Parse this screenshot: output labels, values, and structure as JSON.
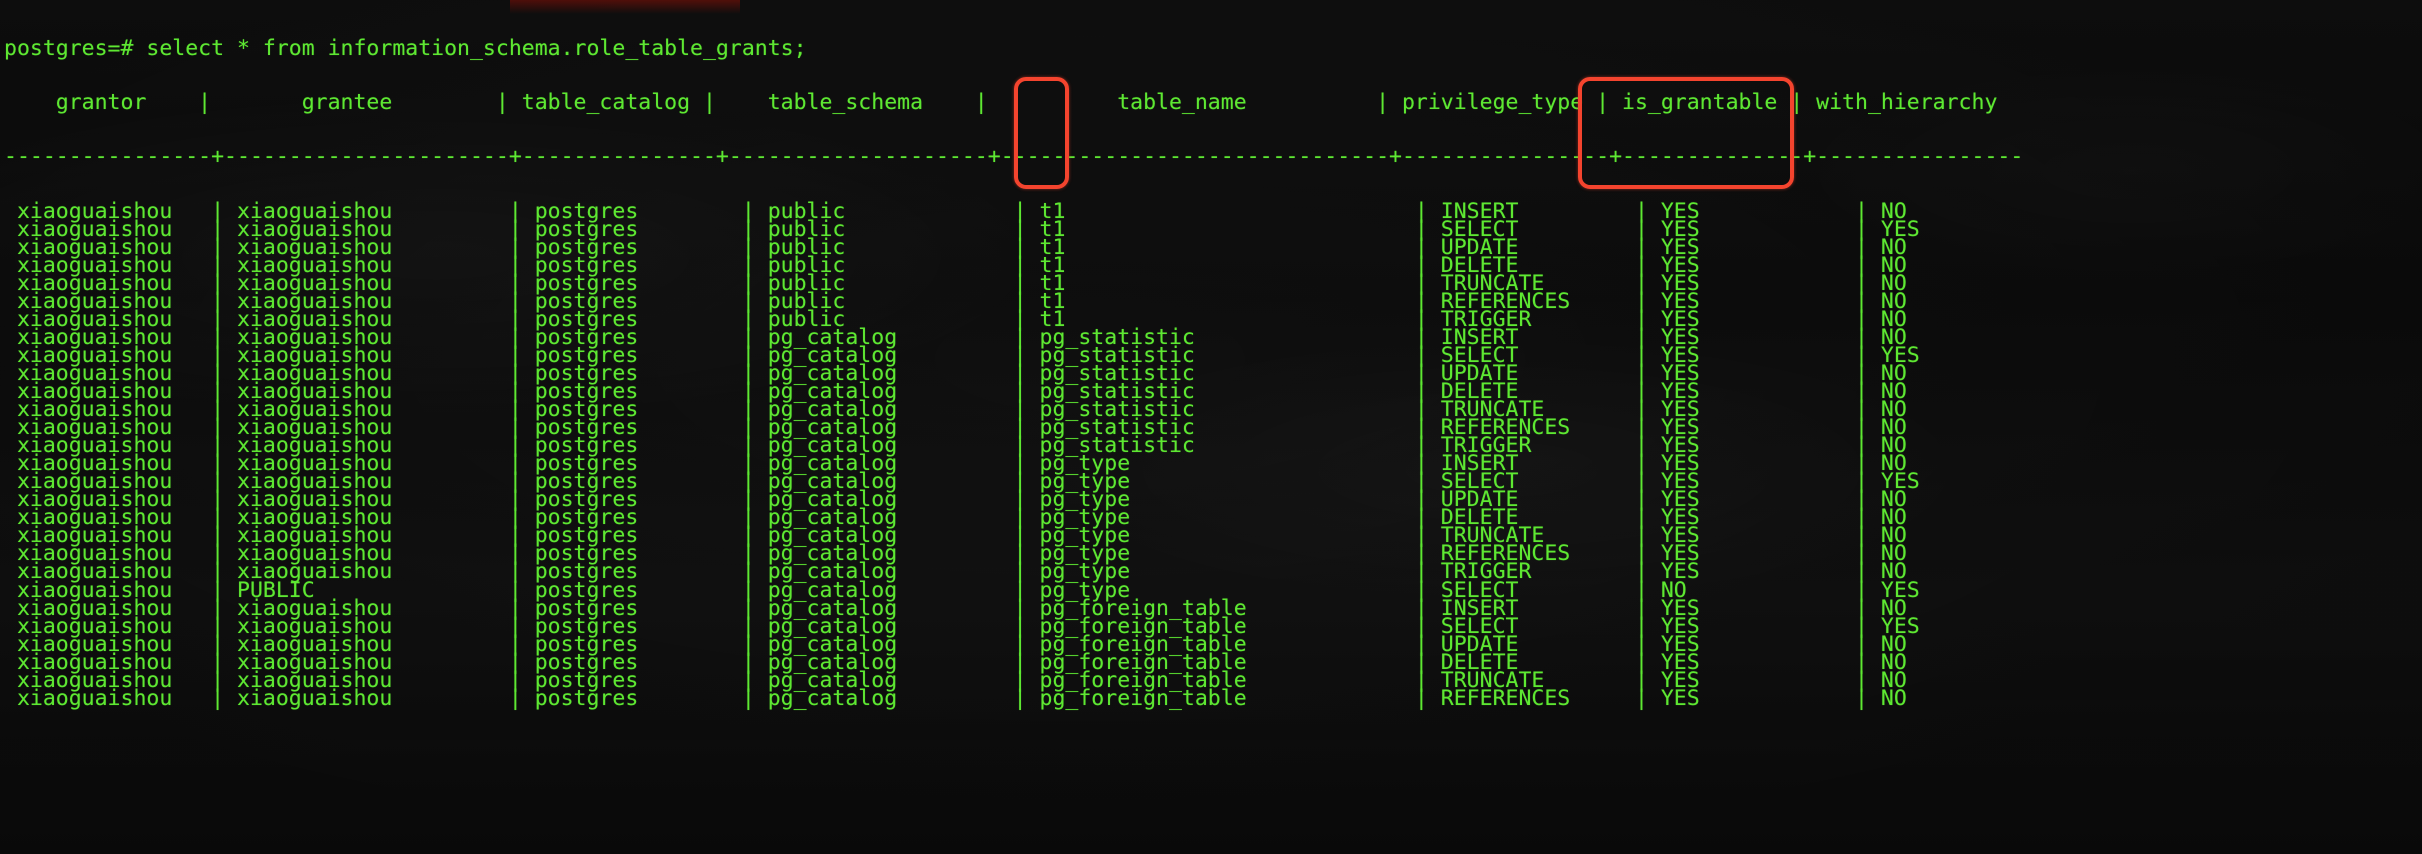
{
  "terminal": {
    "prompt": "postgres=#",
    "command": "select * from information_schema.role_table_grants;",
    "prompt_line": "postgres=# select * from information_schema.role_table_grants;",
    "colors": {
      "foreground": "#5ee832",
      "background": "#111111",
      "highlight": "#f4442e"
    },
    "columns": [
      {
        "name": "grantor",
        "width": 14,
        "align": "center"
      },
      {
        "name": "grantee",
        "width": 20,
        "align": "center"
      },
      {
        "name": "table_catalog",
        "width": 15,
        "align": "center"
      },
      {
        "name": "table_schema",
        "width": 18,
        "align": "center"
      },
      {
        "name": "table_name",
        "width": 28,
        "align": "center"
      },
      {
        "name": "privilege_type",
        "width": 14,
        "align": "center"
      },
      {
        "name": "is_grantable",
        "width": 14,
        "align": "center"
      },
      {
        "name": "with_hierarchy",
        "width": 14,
        "align": "center"
      }
    ],
    "header_line": "    grantor    |       grantee        | table_catalog |    table_schema    |          table_name          | privilege_type | is_grantable | with_hierarchy",
    "separator_line": "----------------+----------------------+---------------+--------------------+------------------------------+----------------+--------------+----------------",
    "rows": [
      {
        "grantor": "xiaoguaishou",
        "grantee": "xiaoguaishou",
        "table_catalog": "postgres",
        "table_schema": "public",
        "table_name": "t1",
        "privilege_type": "INSERT",
        "is_grantable": "YES",
        "with_hierarchy": "NO"
      },
      {
        "grantor": "xiaoguaishou",
        "grantee": "xiaoguaishou",
        "table_catalog": "postgres",
        "table_schema": "public",
        "table_name": "t1",
        "privilege_type": "SELECT",
        "is_grantable": "YES",
        "with_hierarchy": "YES"
      },
      {
        "grantor": "xiaoguaishou",
        "grantee": "xiaoguaishou",
        "table_catalog": "postgres",
        "table_schema": "public",
        "table_name": "t1",
        "privilege_type": "UPDATE",
        "is_grantable": "YES",
        "with_hierarchy": "NO"
      },
      {
        "grantor": "xiaoguaishou",
        "grantee": "xiaoguaishou",
        "table_catalog": "postgres",
        "table_schema": "public",
        "table_name": "t1",
        "privilege_type": "DELETE",
        "is_grantable": "YES",
        "with_hierarchy": "NO"
      },
      {
        "grantor": "xiaoguaishou",
        "grantee": "xiaoguaishou",
        "table_catalog": "postgres",
        "table_schema": "public",
        "table_name": "t1",
        "privilege_type": "TRUNCATE",
        "is_grantable": "YES",
        "with_hierarchy": "NO"
      },
      {
        "grantor": "xiaoguaishou",
        "grantee": "xiaoguaishou",
        "table_catalog": "postgres",
        "table_schema": "public",
        "table_name": "t1",
        "privilege_type": "REFERENCES",
        "is_grantable": "YES",
        "with_hierarchy": "NO"
      },
      {
        "grantor": "xiaoguaishou",
        "grantee": "xiaoguaishou",
        "table_catalog": "postgres",
        "table_schema": "public",
        "table_name": "t1",
        "privilege_type": "TRIGGER",
        "is_grantable": "YES",
        "with_hierarchy": "NO"
      },
      {
        "grantor": "xiaoguaishou",
        "grantee": "xiaoguaishou",
        "table_catalog": "postgres",
        "table_schema": "pg_catalog",
        "table_name": "pg_statistic",
        "privilege_type": "INSERT",
        "is_grantable": "YES",
        "with_hierarchy": "NO"
      },
      {
        "grantor": "xiaoguaishou",
        "grantee": "xiaoguaishou",
        "table_catalog": "postgres",
        "table_schema": "pg_catalog",
        "table_name": "pg_statistic",
        "privilege_type": "SELECT",
        "is_grantable": "YES",
        "with_hierarchy": "YES"
      },
      {
        "grantor": "xiaoguaishou",
        "grantee": "xiaoguaishou",
        "table_catalog": "postgres",
        "table_schema": "pg_catalog",
        "table_name": "pg_statistic",
        "privilege_type": "UPDATE",
        "is_grantable": "YES",
        "with_hierarchy": "NO"
      },
      {
        "grantor": "xiaoguaishou",
        "grantee": "xiaoguaishou",
        "table_catalog": "postgres",
        "table_schema": "pg_catalog",
        "table_name": "pg_statistic",
        "privilege_type": "DELETE",
        "is_grantable": "YES",
        "with_hierarchy": "NO"
      },
      {
        "grantor": "xiaoguaishou",
        "grantee": "xiaoguaishou",
        "table_catalog": "postgres",
        "table_schema": "pg_catalog",
        "table_name": "pg_statistic",
        "privilege_type": "TRUNCATE",
        "is_grantable": "YES",
        "with_hierarchy": "NO"
      },
      {
        "grantor": "xiaoguaishou",
        "grantee": "xiaoguaishou",
        "table_catalog": "postgres",
        "table_schema": "pg_catalog",
        "table_name": "pg_statistic",
        "privilege_type": "REFERENCES",
        "is_grantable": "YES",
        "with_hierarchy": "NO"
      },
      {
        "grantor": "xiaoguaishou",
        "grantee": "xiaoguaishou",
        "table_catalog": "postgres",
        "table_schema": "pg_catalog",
        "table_name": "pg_statistic",
        "privilege_type": "TRIGGER",
        "is_grantable": "YES",
        "with_hierarchy": "NO"
      },
      {
        "grantor": "xiaoguaishou",
        "grantee": "xiaoguaishou",
        "table_catalog": "postgres",
        "table_schema": "pg_catalog",
        "table_name": "pg_type",
        "privilege_type": "INSERT",
        "is_grantable": "YES",
        "with_hierarchy": "NO"
      },
      {
        "grantor": "xiaoguaishou",
        "grantee": "xiaoguaishou",
        "table_catalog": "postgres",
        "table_schema": "pg_catalog",
        "table_name": "pg_type",
        "privilege_type": "SELECT",
        "is_grantable": "YES",
        "with_hierarchy": "YES"
      },
      {
        "grantor": "xiaoguaishou",
        "grantee": "xiaoguaishou",
        "table_catalog": "postgres",
        "table_schema": "pg_catalog",
        "table_name": "pg_type",
        "privilege_type": "UPDATE",
        "is_grantable": "YES",
        "with_hierarchy": "NO"
      },
      {
        "grantor": "xiaoguaishou",
        "grantee": "xiaoguaishou",
        "table_catalog": "postgres",
        "table_schema": "pg_catalog",
        "table_name": "pg_type",
        "privilege_type": "DELETE",
        "is_grantable": "YES",
        "with_hierarchy": "NO"
      },
      {
        "grantor": "xiaoguaishou",
        "grantee": "xiaoguaishou",
        "table_catalog": "postgres",
        "table_schema": "pg_catalog",
        "table_name": "pg_type",
        "privilege_type": "TRUNCATE",
        "is_grantable": "YES",
        "with_hierarchy": "NO"
      },
      {
        "grantor": "xiaoguaishou",
        "grantee": "xiaoguaishou",
        "table_catalog": "postgres",
        "table_schema": "pg_catalog",
        "table_name": "pg_type",
        "privilege_type": "REFERENCES",
        "is_grantable": "YES",
        "with_hierarchy": "NO"
      },
      {
        "grantor": "xiaoguaishou",
        "grantee": "xiaoguaishou",
        "table_catalog": "postgres",
        "table_schema": "pg_catalog",
        "table_name": "pg_type",
        "privilege_type": "TRIGGER",
        "is_grantable": "YES",
        "with_hierarchy": "NO"
      },
      {
        "grantor": "xiaoguaishou",
        "grantee": "PUBLIC",
        "table_catalog": "postgres",
        "table_schema": "pg_catalog",
        "table_name": "pg_type",
        "privilege_type": "SELECT",
        "is_grantable": "NO",
        "with_hierarchy": "YES"
      },
      {
        "grantor": "xiaoguaishou",
        "grantee": "xiaoguaishou",
        "table_catalog": "postgres",
        "table_schema": "pg_catalog",
        "table_name": "pg_foreign_table",
        "privilege_type": "INSERT",
        "is_grantable": "YES",
        "with_hierarchy": "NO"
      },
      {
        "grantor": "xiaoguaishou",
        "grantee": "xiaoguaishou",
        "table_catalog": "postgres",
        "table_schema": "pg_catalog",
        "table_name": "pg_foreign_table",
        "privilege_type": "SELECT",
        "is_grantable": "YES",
        "with_hierarchy": "YES"
      },
      {
        "grantor": "xiaoguaishou",
        "grantee": "xiaoguaishou",
        "table_catalog": "postgres",
        "table_schema": "pg_catalog",
        "table_name": "pg_foreign_table",
        "privilege_type": "UPDATE",
        "is_grantable": "YES",
        "with_hierarchy": "NO"
      },
      {
        "grantor": "xiaoguaishou",
        "grantee": "xiaoguaishou",
        "table_catalog": "postgres",
        "table_schema": "pg_catalog",
        "table_name": "pg_foreign_table",
        "privilege_type": "DELETE",
        "is_grantable": "YES",
        "with_hierarchy": "NO"
      },
      {
        "grantor": "xiaoguaishou",
        "grantee": "xiaoguaishou",
        "table_catalog": "postgres",
        "table_schema": "pg_catalog",
        "table_name": "pg_foreign_table",
        "privilege_type": "TRUNCATE",
        "is_grantable": "YES",
        "with_hierarchy": "NO"
      },
      {
        "grantor": "xiaoguaishou",
        "grantee": "xiaoguaishou",
        "table_catalog": "postgres",
        "table_schema": "pg_catalog",
        "table_name": "pg_foreign_table",
        "privilege_type": "REFERENCES",
        "is_grantable": "YES",
        "with_hierarchy": "NO"
      }
    ],
    "annotations": [
      {
        "name": "table-name-highlight",
        "target_column": "table_name",
        "target_value": "t1",
        "rows": 6,
        "color": "#f4442e"
      },
      {
        "name": "privilege-type-highlight",
        "target_column": "privilege_type",
        "values": [
          "INSERT",
          "SELECT",
          "UPDATE",
          "DELETE",
          "TRUNCATE",
          "REFERENCES"
        ],
        "rows": 6,
        "color": "#f4442e"
      }
    ]
  }
}
